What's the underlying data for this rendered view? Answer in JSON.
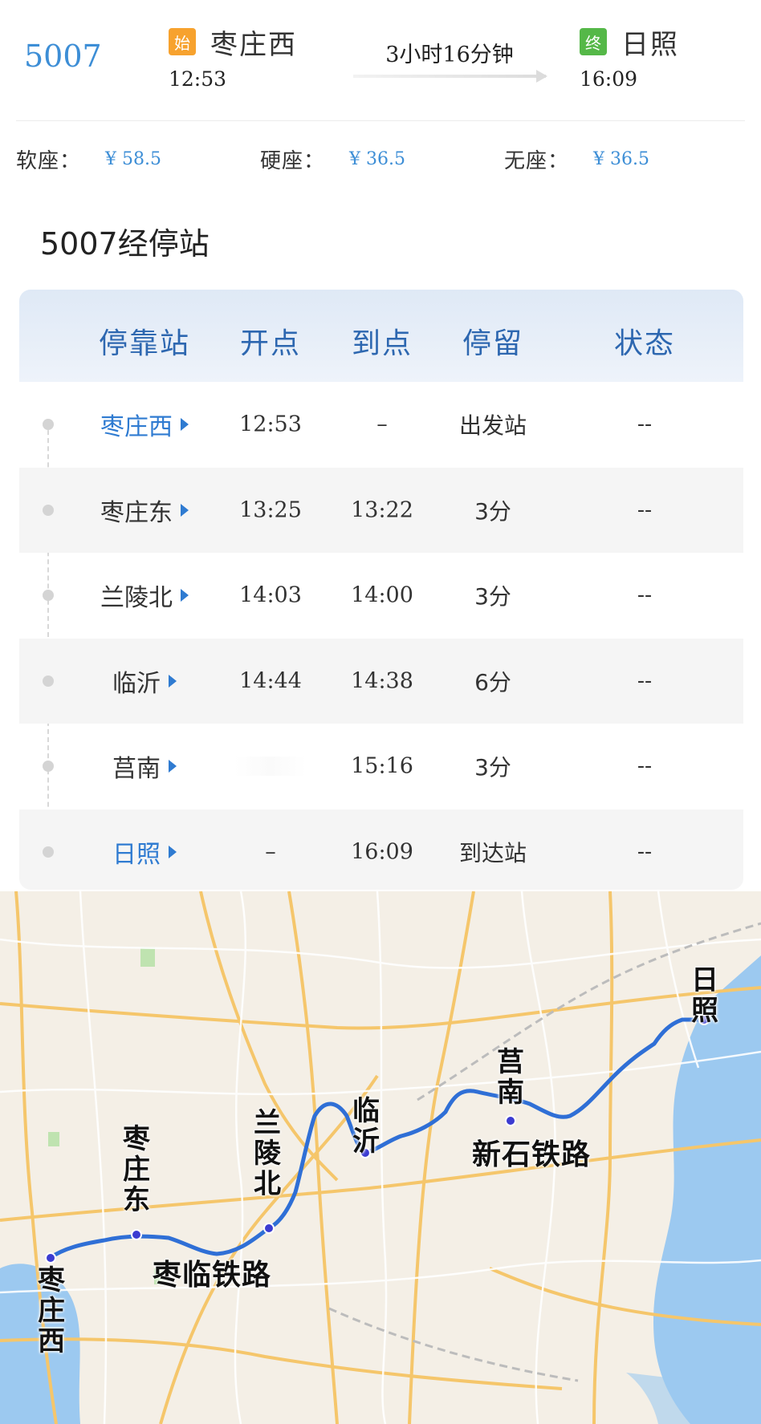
{
  "train": {
    "number": "5007",
    "from": {
      "badge": "始",
      "name": "枣庄西",
      "time": "12:53"
    },
    "to": {
      "badge": "终",
      "name": "日照",
      "time": "16:09"
    },
    "duration": "3小时16分钟"
  },
  "fares": [
    {
      "label": "软座：",
      "price": "¥ 58.5"
    },
    {
      "label": "硬座：",
      "price": "¥ 36.5"
    },
    {
      "label": "无座：",
      "price": "¥ 36.5"
    }
  ],
  "stops_title": "5007经停站",
  "stops_table": {
    "headers": [
      "停靠站",
      "开点",
      "到点",
      "停留",
      "状态"
    ],
    "rows": [
      {
        "station": "枣庄西",
        "depart": "12:53",
        "arrive": "–",
        "stay": "出发站",
        "status": "--"
      },
      {
        "station": "枣庄东",
        "depart": "13:25",
        "arrive": "13:22",
        "stay": "3分",
        "status": "--"
      },
      {
        "station": "兰陵北",
        "depart": "14:03",
        "arrive": "14:00",
        "stay": "3分",
        "status": "--"
      },
      {
        "station": "临沂",
        "depart": "14:44",
        "arrive": "14:38",
        "stay": "6分",
        "status": "--"
      },
      {
        "station": "莒南",
        "depart": "",
        "arrive": "15:16",
        "stay": "3分",
        "status": "--"
      },
      {
        "station": "日照",
        "depart": "–",
        "arrive": "16:09",
        "stay": "到达站",
        "status": "--"
      }
    ]
  },
  "map": {
    "labels": {
      "zaozhuangxi": "枣庄西",
      "zaozhuangdong": "枣庄东",
      "lanlingbei": "兰陵北",
      "linyi": "临沂",
      "junan": "莒南",
      "rizhao": "日照",
      "zaolin_railway": "枣临铁路",
      "xinshi_railway": "新石铁路"
    },
    "route_color": "#2f6fd6",
    "water_color": "#9cc9f0"
  }
}
